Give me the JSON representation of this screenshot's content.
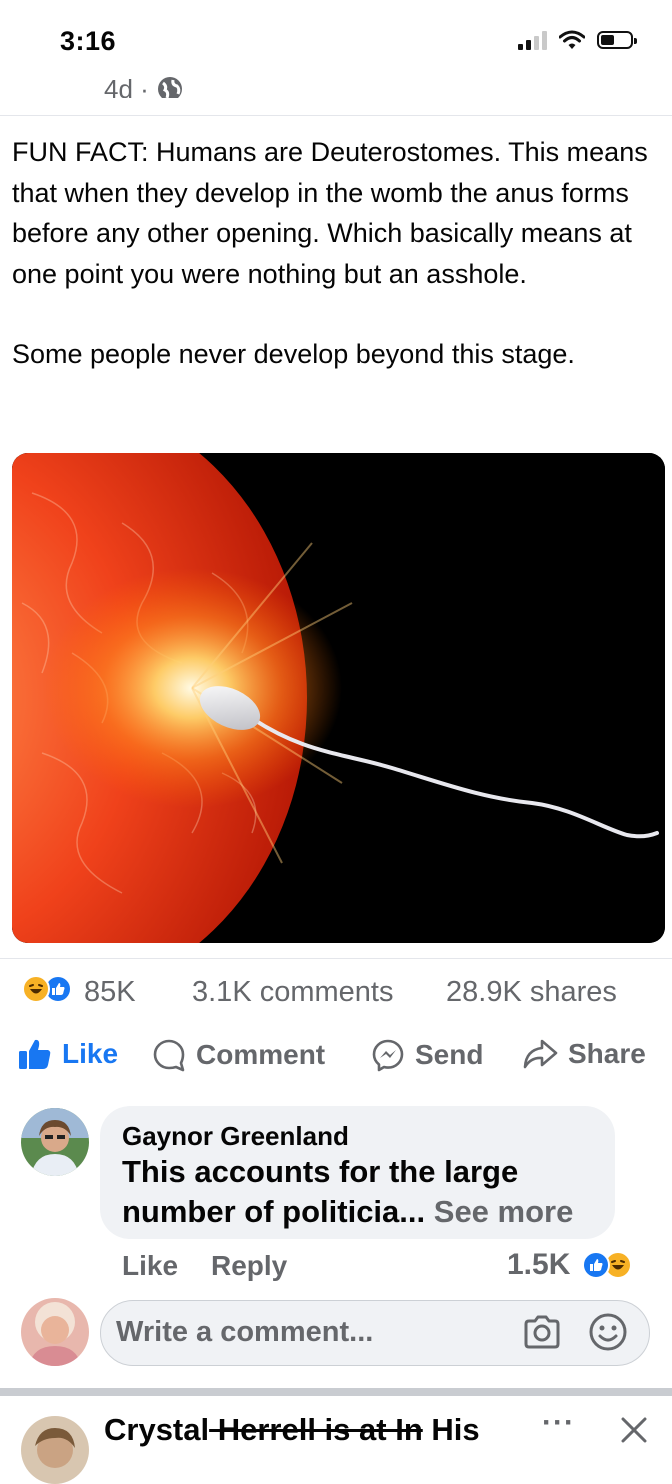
{
  "status_bar": {
    "time": "3:16",
    "signal_bars": 2,
    "battery_percent": 40
  },
  "post": {
    "meta_time": "4d ·",
    "audience_icon": "globe-icon",
    "text_paragraph_1": "FUN FACT: Humans are Deuterostomes. This means that when they develop in the womb the anus forms before any other opening. Which basically means at one point you were nothing but an asshole.",
    "text_paragraph_2": "Some people never develop beyond this stage.",
    "image_subject": "sperm-meets-egg-illustration"
  },
  "stats": {
    "reactions": [
      "haha",
      "like"
    ],
    "reaction_count": "85K",
    "comments": "3.1K comments",
    "shares": "28.9K shares"
  },
  "actions": {
    "like": "Like",
    "comment": "Comment",
    "send": "Send",
    "share": "Share"
  },
  "top_comment": {
    "author": "Gaynor Greenland",
    "text": "This accounts for the large number of politicia...",
    "see_more": "See more",
    "like_label": "Like",
    "reply_label": "Reply",
    "reaction_count": "1.5K",
    "reactions": [
      "like",
      "haha"
    ]
  },
  "composer": {
    "placeholder": "Write a comment...",
    "camera_icon": "camera-icon",
    "emoji_icon": "emoji-icon"
  },
  "next_post": {
    "author_start": "Crystal",
    "author_struck": " Herrell is at In",
    "author_end": " His",
    "more_label": "···",
    "close_icon": "close-icon"
  },
  "colors": {
    "facebook_blue": "#1877f2",
    "secondary_text": "#65676b",
    "bubble_bg": "#f0f2f5",
    "haha_yellow": "#f7b125"
  }
}
